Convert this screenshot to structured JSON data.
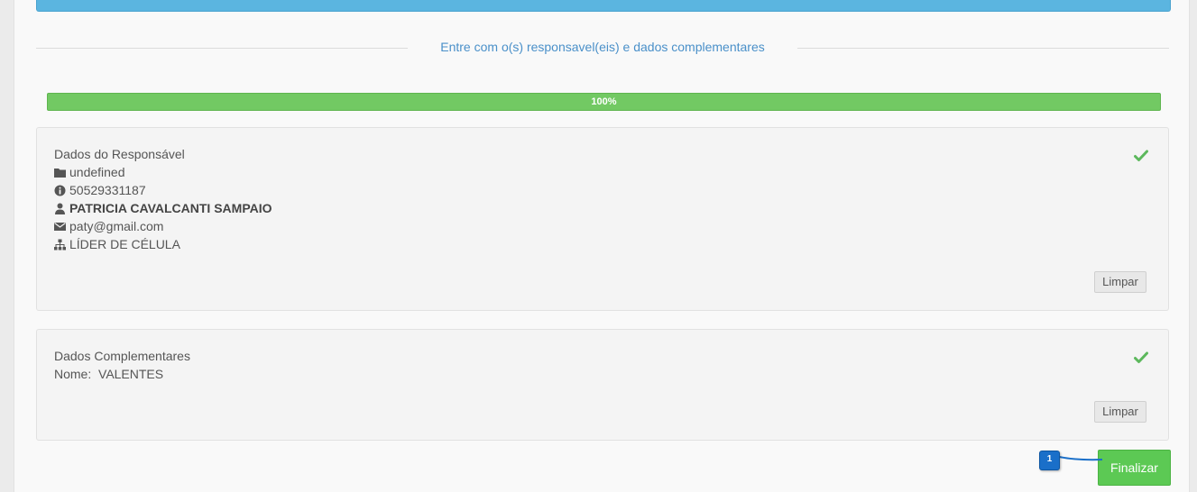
{
  "section": {
    "title": "Entre com o(s) responsavel(eis) e dados complementares"
  },
  "progress": {
    "value": 100,
    "label": "100%"
  },
  "responsavel": {
    "heading": "Dados do Responsável",
    "folder": "undefined",
    "cpf": "50529331187",
    "name": "PATRICIA CAVALCANTI SAMPAIO",
    "email": "paty@gmail.com",
    "role": "LÍDER DE CÉLULA",
    "clear_label": "Limpar"
  },
  "complementares": {
    "heading": "Dados Complementares",
    "nome": "Nome:  VALENTES",
    "clear_label": "Limpar"
  },
  "actions": {
    "finalizar_label": "Finalizar",
    "step_badge": "1"
  },
  "colors": {
    "accent": "#4a90c9",
    "success": "#5cc954",
    "topbar": "#5bb5e0",
    "badge": "#1a6fc9"
  }
}
